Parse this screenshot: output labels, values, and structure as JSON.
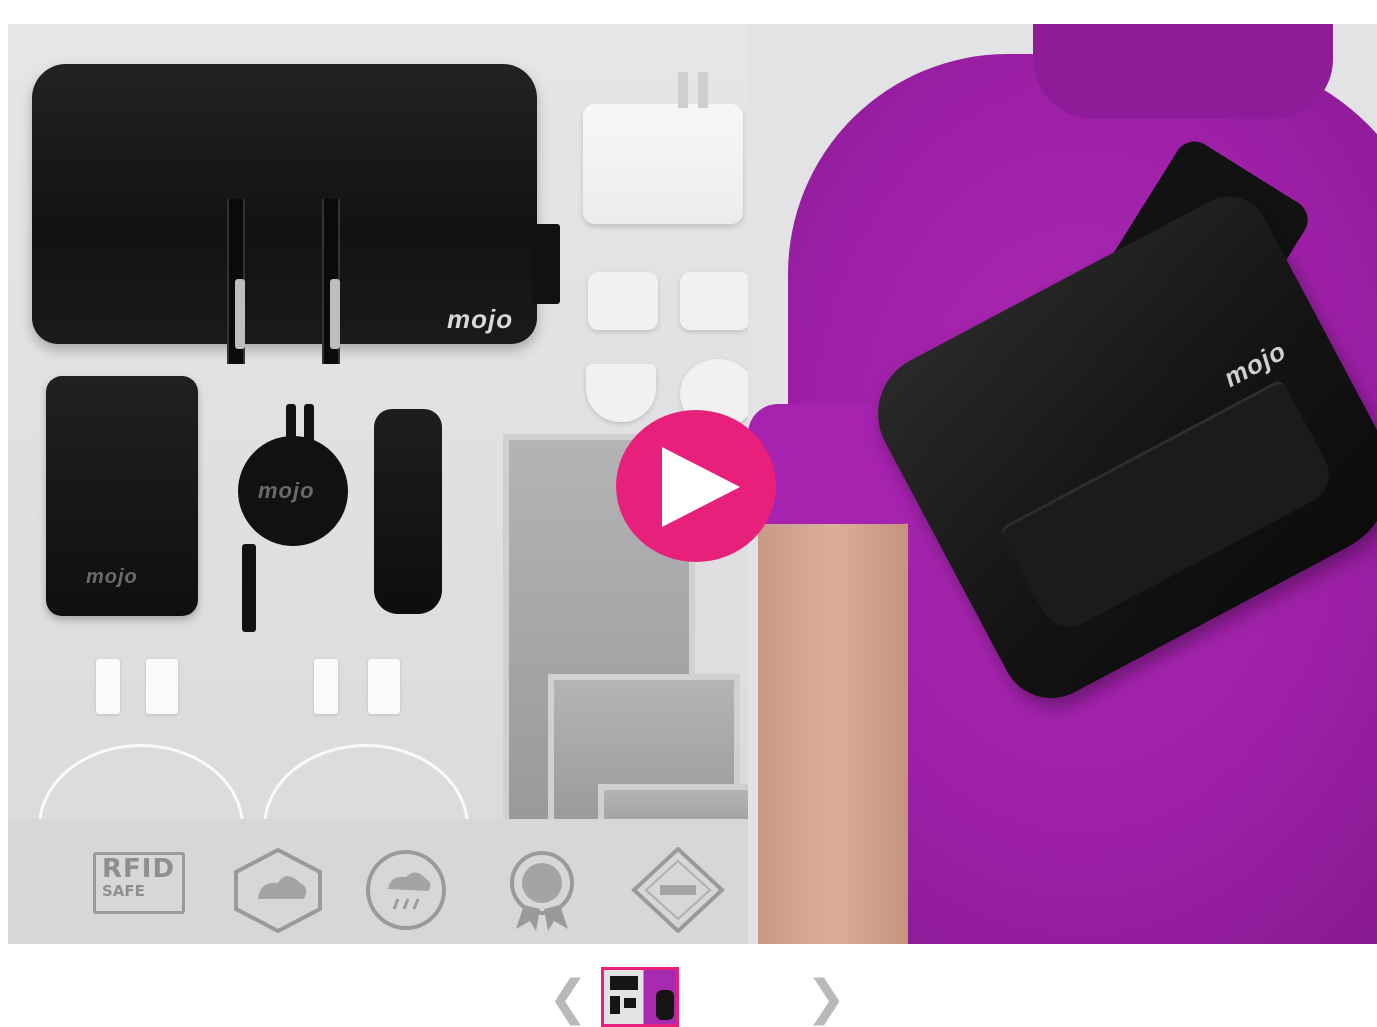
{
  "hero": {
    "image_alt": "Mojo travel kit with sling bag worn by model",
    "brand_logo": "mojo",
    "badges": [
      "RFID SAFE"
    ],
    "rfid_line1": "RFID",
    "rfid_line2": "SAFE"
  },
  "video": {
    "play_icon": "play-icon",
    "accent_color": "#e7207c"
  },
  "carousel": {
    "prev_glyph": "❮",
    "next_glyph": "❯",
    "active_thumb": 1,
    "thumb_count": 1
  },
  "colors": {
    "shirt": "#9c1fa6",
    "accent": "#e7207c",
    "background": "#e1e1e3"
  }
}
